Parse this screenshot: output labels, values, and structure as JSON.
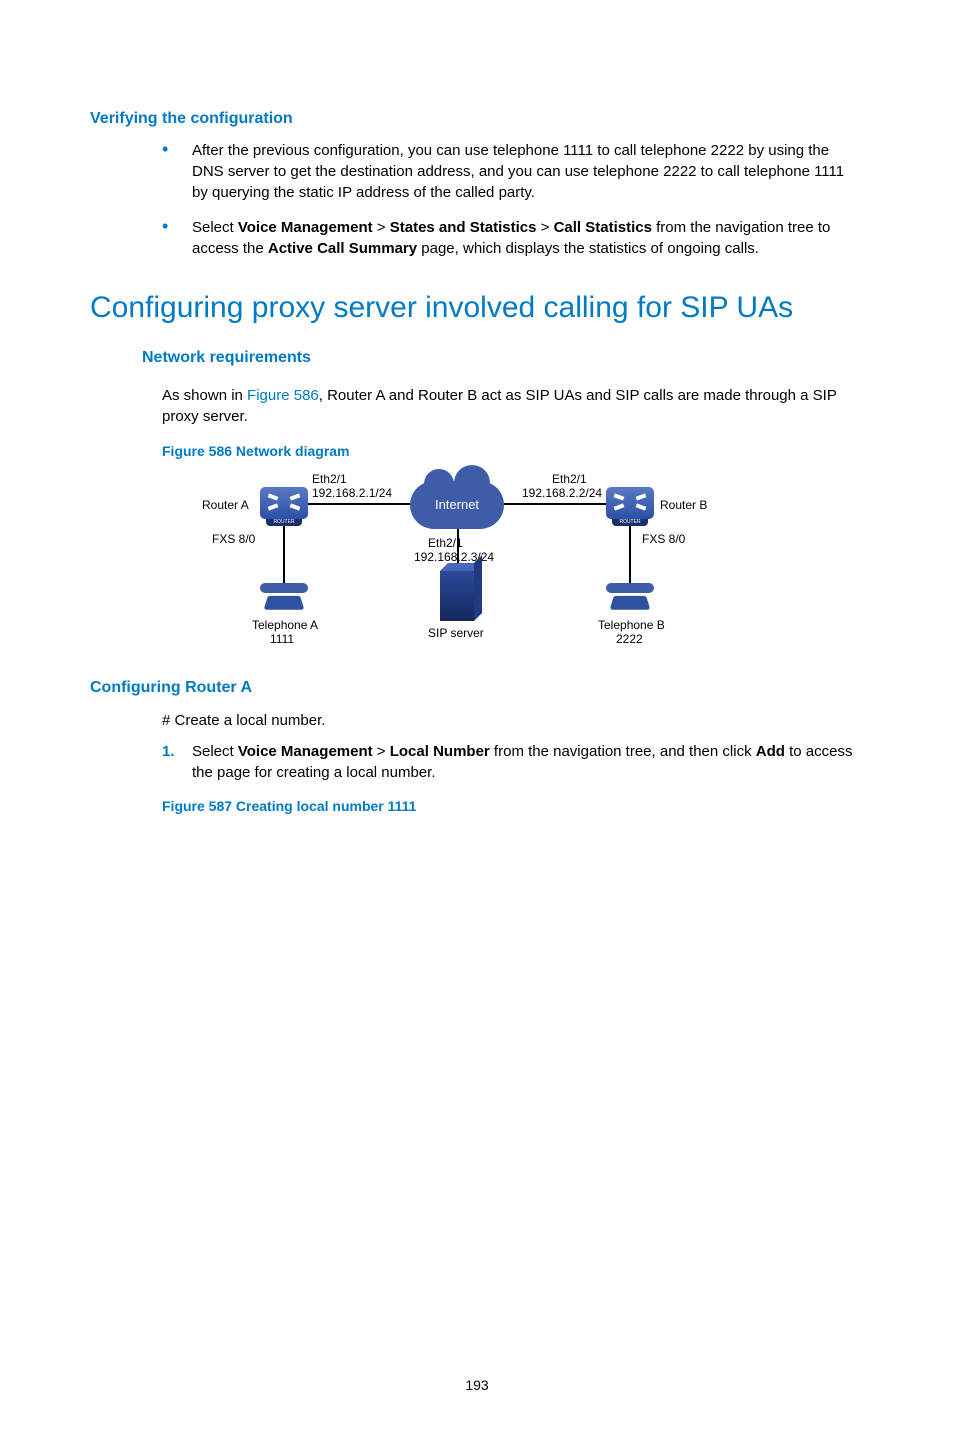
{
  "sections": {
    "verify": {
      "title": "Verifying the configuration",
      "bullet1": "After the previous configuration, you can use telephone 1111 to call telephone 2222 by using the DNS server to get the destination address, and you can use telephone 2222 to call telephone 1111 by querying the static IP address of the called party.",
      "bullet2_pre": "Select ",
      "bullet2_b1": "Voice Management",
      "bullet2_gt1": " > ",
      "bullet2_b2": "States and Statistics",
      "bullet2_gt2": " > ",
      "bullet2_b3": "Call Statistics",
      "bullet2_mid": " from the navigation tree to access the ",
      "bullet2_b4": "Active Call Summary",
      "bullet2_end": " page, which displays the statistics of ongoing calls."
    },
    "configuring": {
      "title": "Configuring proxy server involved calling for SIP UAs"
    },
    "netreq": {
      "title": "Network requirements",
      "p_pre": "As shown in ",
      "p_ref": "Figure 586",
      "p_post": ", Router A and Router B act as SIP UAs and SIP calls are made through a SIP proxy server."
    },
    "fig586": {
      "caption": "Figure 586 Network diagram",
      "routerA": "Router A",
      "routerB": "Router B",
      "ethA_if": "Eth2/1",
      "ethA_ip": "192.168.2.1/24",
      "ethB_if": "Eth2/1",
      "ethB_ip": "192.168.2.2/24",
      "ethS_if": "Eth2/1",
      "ethS_ip": "192.168.2.3/24",
      "fxsA": "FXS 8/0",
      "fxsB": "FXS 8/0",
      "internet": "Internet",
      "sipserver": "SIP server",
      "telA": "Telephone A",
      "telA_num": "1111",
      "telB": "Telephone B",
      "telB_num": "2222"
    },
    "cfgA": {
      "title": "Configuring Router A",
      "intro": "# Create a local number.",
      "step1_pre": "Select ",
      "step1_b1": "Voice Management",
      "step1_gt": " > ",
      "step1_b2": "Local Number",
      "step1_mid": " from the navigation tree, and then click ",
      "step1_b3": "Add",
      "step1_end": " to access the page for creating a local number."
    },
    "fig587": {
      "caption": "Figure 587 Creating local number 1111"
    }
  },
  "page": "193"
}
